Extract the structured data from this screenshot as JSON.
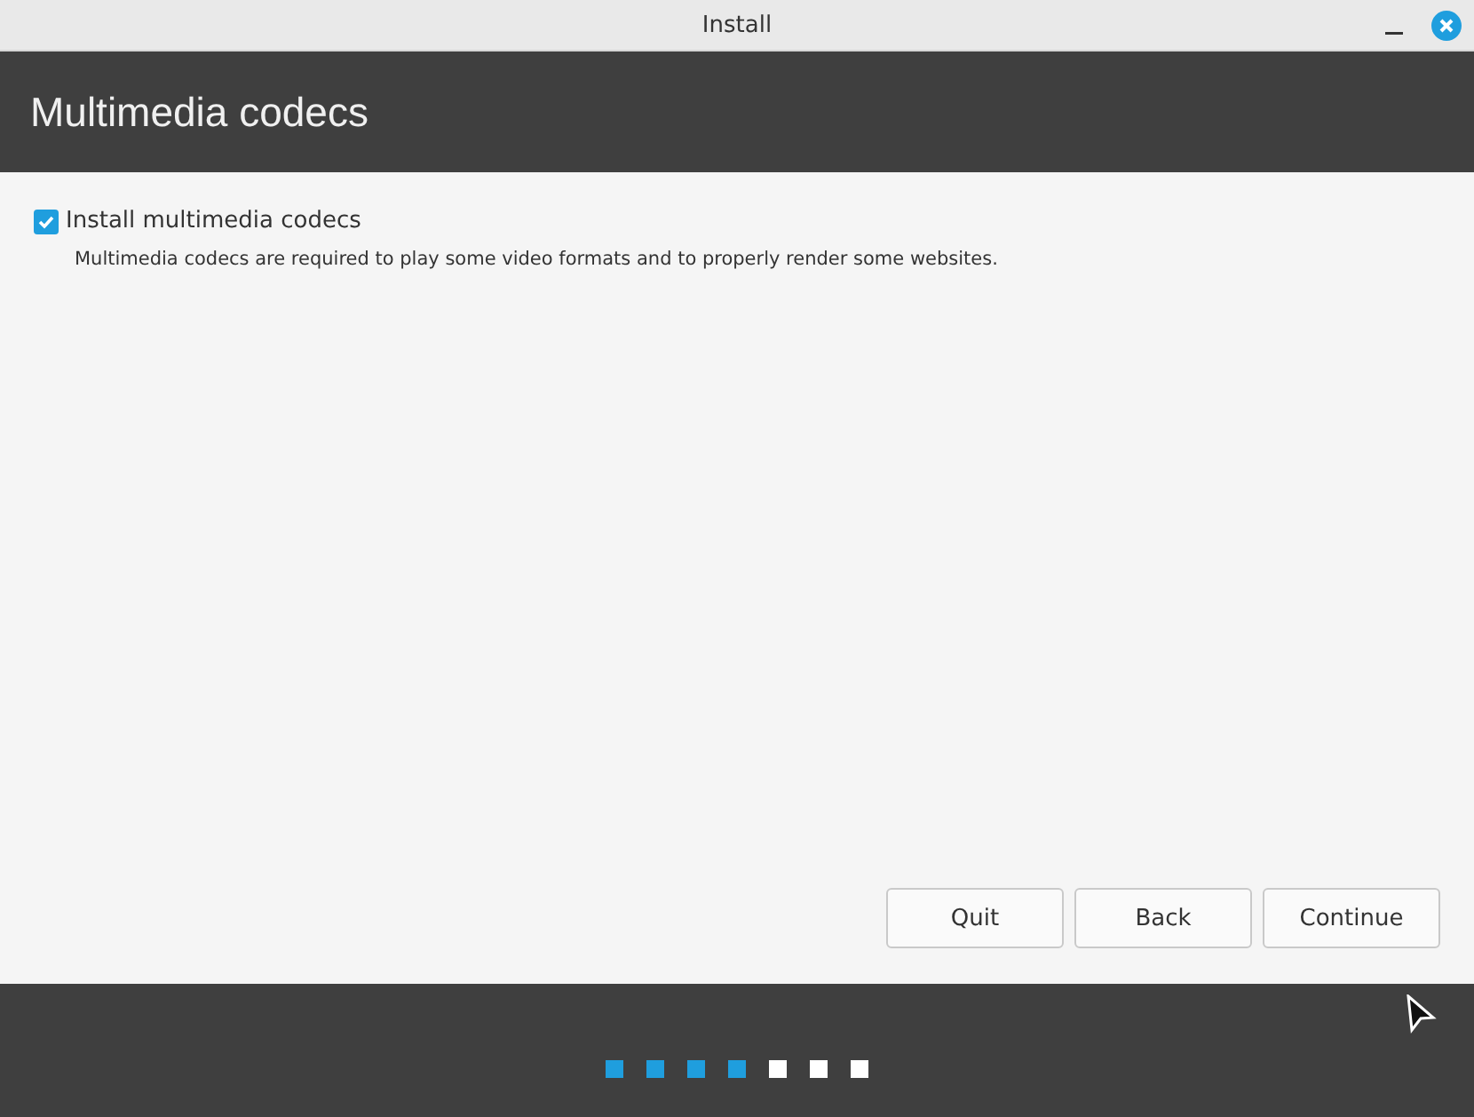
{
  "window": {
    "title": "Install"
  },
  "header": {
    "title": "Multimedia codecs"
  },
  "option": {
    "label": "Install multimedia codecs",
    "checked": true,
    "description": "Multimedia codecs are required to play some video formats and to properly render some websites."
  },
  "buttons": [
    "Quit",
    "Back",
    "Continue"
  ],
  "steps": [
    {
      "completed": true
    },
    {
      "completed": true
    },
    {
      "completed": true
    },
    {
      "completed": true
    },
    {
      "completed": false
    },
    {
      "completed": false
    },
    {
      "completed": false
    }
  ]
}
